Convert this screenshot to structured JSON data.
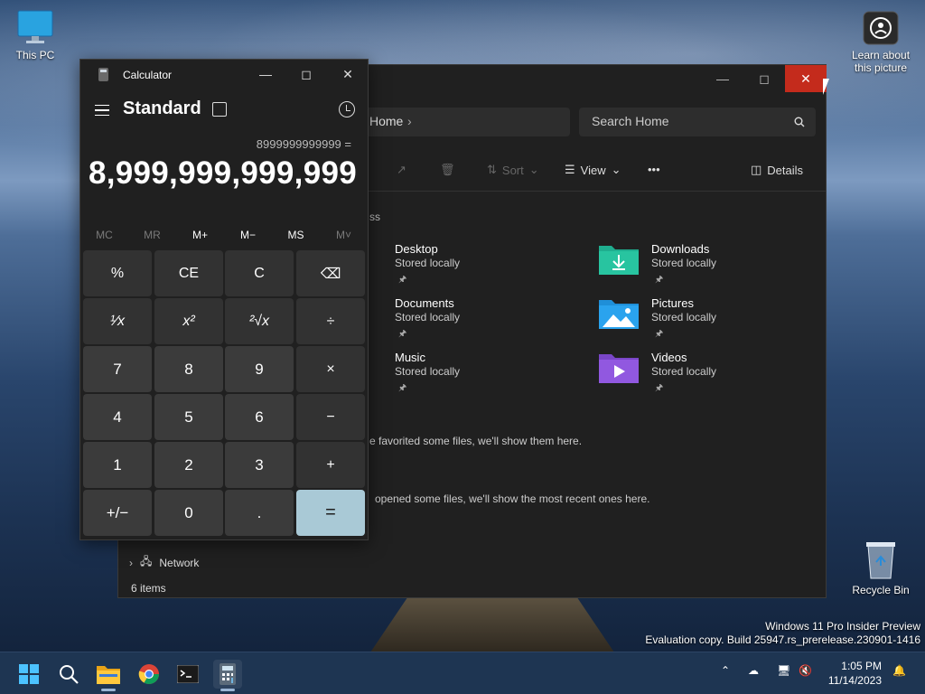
{
  "desktop": {
    "this_pc_label": "This PC",
    "learn_label_line1": "Learn about",
    "learn_label_line2": "this picture",
    "recycle_label": "Recycle Bin",
    "watermark_line1": "Windows 11 Pro Insider Preview",
    "watermark_line2": "Evaluation copy. Build 25947.rs_prerelease.230901-1416"
  },
  "explorer": {
    "address": "Home",
    "search_placeholder": "Search Home",
    "toolbar": {
      "sort": "Sort",
      "view": "View",
      "more": "•••",
      "details": "Details"
    },
    "section_quick_access": "ss",
    "quick_access": [
      {
        "name": "Desktop",
        "sub": "Stored locally",
        "icon": "desktop-folder-icon"
      },
      {
        "name": "Downloads",
        "sub": "Stored locally",
        "icon": "downloads-folder-icon"
      },
      {
        "name": "Documents",
        "sub": "Stored locally",
        "icon": "documents-folder-icon"
      },
      {
        "name": "Pictures",
        "sub": "Stored locally",
        "icon": "pictures-folder-icon"
      },
      {
        "name": "Music",
        "sub": "Stored locally",
        "icon": "music-folder-icon"
      },
      {
        "name": "Videos",
        "sub": "Stored locally",
        "icon": "videos-folder-icon"
      }
    ],
    "favorites_msg": "e favorited some files, we'll show them here.",
    "recent_msg": "opened some files, we'll show the most recent ones here.",
    "network_label": "Network",
    "status_items": "6 items"
  },
  "calculator": {
    "title": "Calculator",
    "mode": "Standard",
    "expression": "8999999999999 =",
    "display": "8,999,999,999,999",
    "memory": [
      {
        "label": "MC",
        "enabled": false
      },
      {
        "label": "MR",
        "enabled": false
      },
      {
        "label": "M+",
        "enabled": true
      },
      {
        "label": "M−",
        "enabled": true
      },
      {
        "label": "MS",
        "enabled": true
      },
      {
        "label": "M˅",
        "enabled": false
      }
    ],
    "keys": {
      "percent": "%",
      "ce": "CE",
      "c": "C",
      "backspace": "⌫",
      "reciprocal": "¹⁄x",
      "square": "x²",
      "sqrt": "²√x",
      "divide": "÷",
      "k7": "7",
      "k8": "8",
      "k9": "9",
      "multiply": "×",
      "k4": "4",
      "k5": "5",
      "k6": "6",
      "minus": "−",
      "k1": "1",
      "k2": "2",
      "k3": "3",
      "plus": "+",
      "negate": "+/−",
      "k0": "0",
      "decimal": ".",
      "equals": "="
    }
  },
  "taskbar": {
    "time": "1:05 PM",
    "date": "11/14/2023"
  }
}
